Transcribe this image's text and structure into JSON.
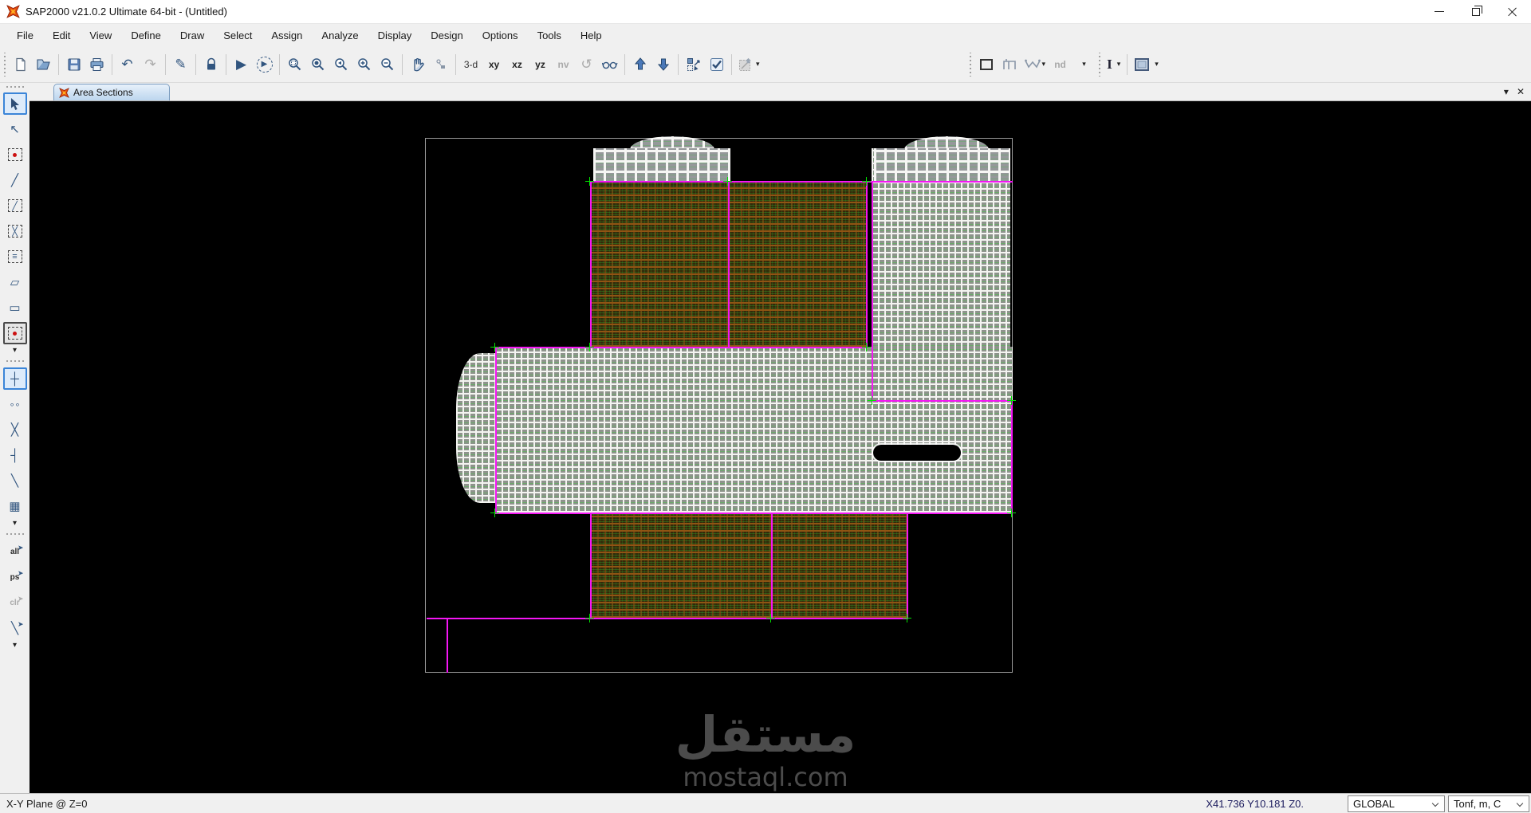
{
  "window": {
    "title": "SAP2000 v21.0.2 Ultimate 64-bit - (Untitled)"
  },
  "menu": {
    "items": [
      "File",
      "Edit",
      "View",
      "Define",
      "Draw",
      "Select",
      "Assign",
      "Analyze",
      "Display",
      "Design",
      "Options",
      "Tools",
      "Help"
    ]
  },
  "toolbar": {
    "icon_names": [
      "new-model-icon",
      "open-file-icon",
      "save-icon",
      "print-icon",
      "undo-icon",
      "redo-icon",
      "pencil-icon",
      "lock-icon",
      "run-analysis-icon",
      "run-animation-icon",
      "rubber-band-zoom-icon",
      "restore-full-view-icon",
      "previous-zoom-icon",
      "zoom-in-icon",
      "zoom-out-icon",
      "pan-icon",
      "shrink-objects-icon",
      "rotate-view-icon",
      "glasses-icon",
      "move-up-icon",
      "move-down-icon",
      "select-mode-icon",
      "check-icon",
      "assign-copy-icon",
      "frame-rect-icon",
      "frame-h-icon",
      "curve-m-icon",
      "i-beam-icon",
      "area-panel-icon"
    ],
    "labels": {
      "d3": "3-d",
      "xy": "xy",
      "xz": "xz",
      "yz": "yz",
      "nv": "nv",
      "nd": "nd"
    }
  },
  "icons": {
    "undo": "↶",
    "redo": "↷",
    "pencil": "✎",
    "play": "▶",
    "rotate": "↺",
    "chevron_down": "▾",
    "tab_menu": "▾",
    "tab_close": "✕",
    "reshape": "↖",
    "frame_line": "╱",
    "braces": "╳",
    "secondary_beams": "≡",
    "poly_area": "▱",
    "rect_area": "▭",
    "snap_joints": "┼",
    "snap_ends": "∘∘",
    "snap_intersections": "╳",
    "snap_perpendicular": "┤",
    "snap_lines": "╲",
    "snap_grid": "▦",
    "select_line": "╲"
  },
  "tabbar": {
    "tab_label": "Area Sections"
  },
  "sidebar": {
    "icon_names": [
      "select-pointer-icon",
      "reshape-icon",
      "special-joint-icon",
      "draw-frame-icon",
      "quick-frame-icon",
      "quick-braces-icon",
      "secondary-beams-icon",
      "poly-area-icon",
      "rect-area-icon",
      "quick-area-icon",
      "snap-joints-icon",
      "snap-ends-icon",
      "snap-intersections-icon",
      "snap-perpendicular-icon",
      "snap-lines-icon",
      "snap-grid-icon",
      "select-all-icon",
      "previous-selection-icon",
      "clear-selection-icon",
      "select-line-icon"
    ],
    "labels": {
      "all": "all",
      "ps": "ps",
      "clr": "clr"
    }
  },
  "statusbar": {
    "left_text": "X-Y Plane @ Z=0",
    "coordinates": "X41.736  Y10.181  Z0.",
    "coordinate_system": "GLOBAL",
    "units": "Tonf, m, C"
  },
  "watermark": {
    "arabic": "مستقل",
    "latin": "mostaql.com"
  },
  "colors": {
    "selection_magenta": "#F416F4",
    "handle_green": "#00E400",
    "canvas_background": "#000000",
    "slab_cell_gray": "#8E938C",
    "slab_line_white": "#F4F4F1",
    "brown_cell": "#33290A",
    "brown_line": "#905413",
    "tab_blue": "#BCD6EE"
  }
}
